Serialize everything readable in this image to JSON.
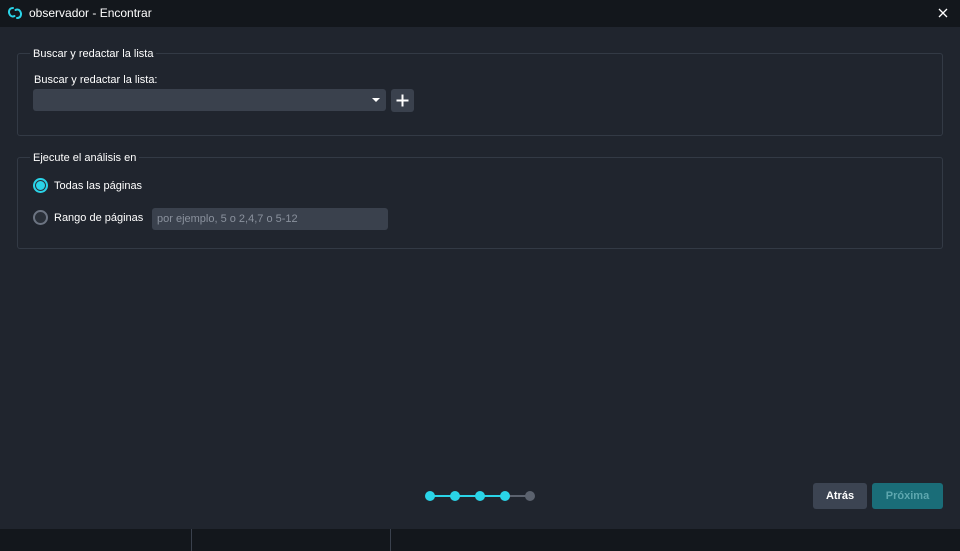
{
  "window": {
    "title": "observador - Encontrar",
    "logo_icon": "app-logo-icon",
    "close_icon": "close-icon"
  },
  "search_list": {
    "legend": "Buscar y redactar la lista",
    "field_label": "Buscar y redactar la lista:",
    "selected_value": "",
    "add_icon": "plus-icon"
  },
  "analysis": {
    "legend": "Ejecute el análisis en",
    "options": [
      {
        "label": "Todas las páginas",
        "checked": true
      },
      {
        "label": "Rango de páginas",
        "checked": false
      }
    ],
    "range_placeholder": "por ejemplo, 5 o 2,4,7 o 5-12",
    "range_value": ""
  },
  "wizard": {
    "total_steps": 5,
    "current_step": 4,
    "active_color": "#2ad4e8",
    "inactive_color": "#5b626e"
  },
  "footer": {
    "back_label": "Atrás",
    "next_label": "Próxima"
  },
  "colors": {
    "accent": "#2ad4e8",
    "background": "#20252e",
    "titlebar": "#13171c",
    "next_button": "#1a6d78"
  }
}
